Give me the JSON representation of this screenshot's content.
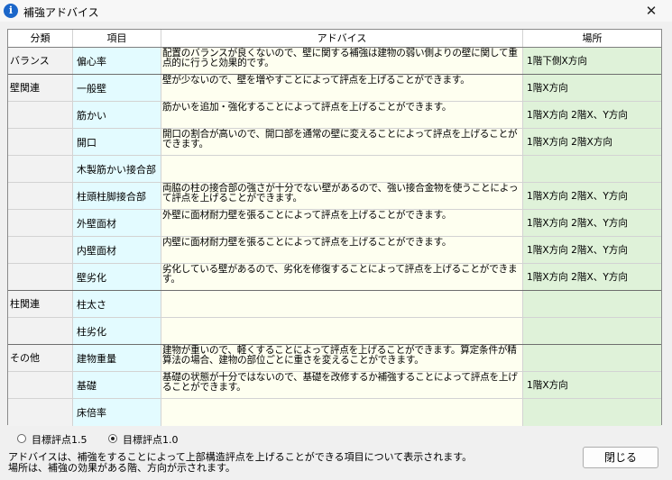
{
  "window": {
    "title": "補強アドバイス",
    "close_symbol": "✕"
  },
  "table": {
    "headers": [
      "分類",
      "項目",
      "アドバイス",
      "場所"
    ],
    "rows": [
      {
        "category": "バランス",
        "item": "偏心率",
        "advice": "配置のバランスが良くないので、壁に関する補強は建物の弱い側よりの壁に関して重点的に行うと効果的です。",
        "location": "1階下側X方向"
      },
      {
        "category": "壁関連",
        "item": "一般壁",
        "advice": "壁が少ないので、壁を増やすことによって評点を上げることができます。",
        "location": "1階X方向"
      },
      {
        "category": "",
        "item": "筋かい",
        "advice": "筋かいを追加・強化することによって評点を上げることができます。",
        "location": "1階X方向 2階X、Y方向"
      },
      {
        "category": "",
        "item": "開口",
        "advice": "開口の割合が高いので、開口部を通常の壁に変えることによって評点を上げることができます。",
        "location": "1階X方向 2階X方向"
      },
      {
        "category": "",
        "item": "木製筋かい接合部",
        "advice": "",
        "location": ""
      },
      {
        "category": "",
        "item": "柱頭柱脚接合部",
        "advice": "両脇の柱の接合部の強さが十分でない壁があるので、強い接合金物を使うことによって評点を上げることができます。",
        "location": "1階X方向 2階X、Y方向"
      },
      {
        "category": "",
        "item": "外壁面材",
        "advice": "外壁に面材耐力壁を張ることによって評点を上げることができます。",
        "location": "1階X方向 2階X、Y方向"
      },
      {
        "category": "",
        "item": "内壁面材",
        "advice": "内壁に面材耐力壁を張ることによって評点を上げることができます。",
        "location": "1階X方向 2階X、Y方向"
      },
      {
        "category": "",
        "item": "壁劣化",
        "advice": "劣化している壁があるので、劣化を修復することによって評点を上げることができます。",
        "location": "1階X方向 2階X、Y方向"
      },
      {
        "category": "柱関連",
        "item": "柱太さ",
        "advice": "",
        "location": ""
      },
      {
        "category": "",
        "item": "柱劣化",
        "advice": "",
        "location": ""
      },
      {
        "category": "その他",
        "item": "建物重量",
        "advice": "建物が重いので、軽くすることによって評点を上げることができます。算定条件が精算法の場合、建物の部位ごとに重さを変えることができます。",
        "location": ""
      },
      {
        "category": "",
        "item": "基礎",
        "advice": "基礎の状態が十分ではないので、基礎を改修するか補強することによって評点を上げることができます。",
        "location": "1階X方向"
      },
      {
        "category": "",
        "item": "床倍率",
        "advice": "",
        "location": ""
      }
    ]
  },
  "target_options": {
    "option1": "目標評点1.5",
    "option2": "目標評点1.0",
    "selected": "目標評点1.0"
  },
  "footer": {
    "line1": "アドバイスは、補強をすることによって上部構造評点を上げることができる項目について表示されます。",
    "line2": "場所は、補強の効果がある階、方向が示されます。"
  },
  "buttons": {
    "close_label": "閉じる"
  }
}
